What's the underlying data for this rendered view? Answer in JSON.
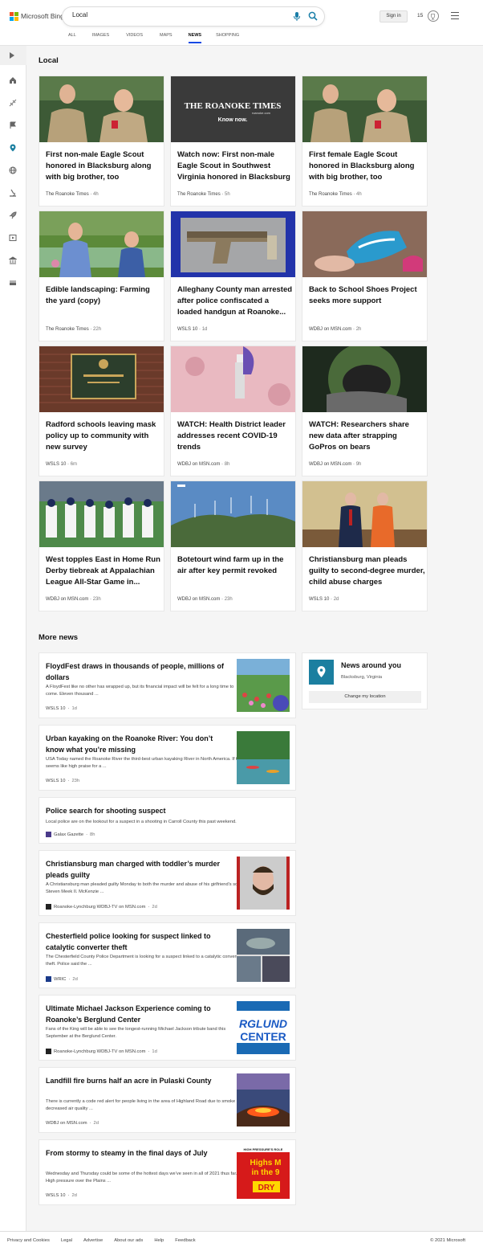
{
  "header": {
    "logo_text": "Microsoft Bing",
    "search_value": "Local",
    "signin_label": "Sign in",
    "rewards_count": "15"
  },
  "tabs": [
    "ALL",
    "IMAGES",
    "VIDEOS",
    "MAPS",
    "NEWS",
    "SHOPPING"
  ],
  "local": {
    "title": "Local",
    "cards": [
      {
        "title": "First non-male Eagle Scout honored in Blacksburg along with big brother, too",
        "source": "The Roanoke Times",
        "age": "4h"
      },
      {
        "title": "Watch now: First non-male Eagle Scout in Southwest Virginia honored in Blacksburg",
        "source": "The Roanoke Times",
        "age": "5h",
        "image_text": "THE ROANOKE TIMES",
        "image_sub": "roanoke.com",
        "image_cta": "Know now."
      },
      {
        "title": "First female Eagle Scout honored in Blacksburg along with big brother, too",
        "source": "The Roanoke Times",
        "age": "4h"
      },
      {
        "title": "Edible landscaping: Farming the yard (copy)",
        "source": "The Roanoke Times",
        "age": "22h"
      },
      {
        "title": "Alleghany County man arrested after police confiscated a loaded handgun at Roanoke...",
        "source": "WSLS 10",
        "age": "1d"
      },
      {
        "title": "Back to School Shoes Project seeks more support",
        "source": "WDBJ on MSN.com",
        "age": "2h"
      },
      {
        "title": "Radford schools leaving mask policy up to community with new survey",
        "source": "WSLS 10",
        "age": "6m"
      },
      {
        "title": "WATCH: Health District leader addresses recent COVID-19 trends",
        "source": "WDBJ on MSN.com",
        "age": "8h"
      },
      {
        "title": "WATCH: Researchers share new data after strapping GoPros on bears",
        "source": "WDBJ on MSN.com",
        "age": "9h"
      },
      {
        "title": "West topples East in Home Run Derby tiebreak at Appalachian League All-Star Game in...",
        "source": "WDBJ on MSN.com",
        "age": "23h"
      },
      {
        "title": "Botetourt wind farm up in the air after key permit revoked",
        "source": "WDBJ on MSN.com",
        "age": "23h"
      },
      {
        "title": "Christiansburg man pleads guilty to second-degree murder, child abuse charges",
        "source": "WSLS 10",
        "age": "2d"
      }
    ]
  },
  "more_news": {
    "title": "More news",
    "items": [
      {
        "title": "FloydFest draws in thousands of people, millions of dollars",
        "snippet": "A FloydFest like no other has wrapped up, but its financial impact will be felt for a long time to come. Eleven thousand ...",
        "source": "WSLS 10",
        "age": "1d"
      },
      {
        "title": "Urban kayaking on the Roanoke River: You don’t know what you’re missing",
        "snippet": "USA Today named the Roanoke River the third-best urban kayaking River in North America. If that seems like high praise for a ...",
        "source": "WSLS 10",
        "age": "23h"
      },
      {
        "title": "Police search for shooting suspect",
        "snippet": "Local police are on the lookout for a suspect in a shooting in Carroll County this past weekend.",
        "source": "Galax Gazette",
        "age": "8h"
      },
      {
        "title": "Christiansburg man charged with toddler’s murder pleads guilty",
        "snippet": "A Christiansburg man pleaded guilty Monday to both the murder and abuse of his girlfriend’s son, Steven Meek II. McKenzie ...",
        "source": "Roanoke-Lynchburg WDBJ-TV on MSN.com",
        "age": "2d"
      },
      {
        "title": "Chesterfield police looking for suspect linked to catalytic converter theft",
        "snippet": "The Chesterfield County Police Department is looking for a suspect linked to a catalytic converter theft. Police said the ...",
        "source": "WRIC",
        "age": "2d"
      },
      {
        "title": "Ultimate Michael Jackson Experience coming to Roanoke’s Berglund Center",
        "snippet": "Fans of the King will be able to see the longest-running Michael Jackson tribute band this September at the Berglund Center.",
        "source": "Roanoke-Lynchburg WDBJ-TV on MSN.com",
        "age": "1d",
        "image_text1": "RGLUND",
        "image_text2": "CENTER"
      },
      {
        "title": "Landfill fire burns half an acre in Pulaski County",
        "snippet": "There is currently a code red alert for people living in the area of Highland Road due to smoke and decreased air quality ...",
        "source": "WDBJ on MSN.com",
        "age": "2d"
      },
      {
        "title": "From stormy to steamy in the final days of July",
        "snippet": "Wednesday and Thursday could be some of the hottest days we’ve seen in all of 2021 thus far. High pressure over the Plains ...",
        "source": "WSLS 10",
        "age": "2d",
        "image_text1": "HIGH PRESSURE'S ROLE",
        "image_text2": "Highs M",
        "image_text3": "in the 9",
        "image_text4": "DRY"
      }
    ]
  },
  "around": {
    "title": "News around you",
    "location": "Blacksburg, Virginia",
    "button": "Change my location"
  },
  "footer": {
    "links": [
      "Privacy and Cookies",
      "Legal",
      "Advertise",
      "About our ads",
      "Help",
      "Feedback"
    ],
    "copyright": "© 2021 Microsoft"
  }
}
